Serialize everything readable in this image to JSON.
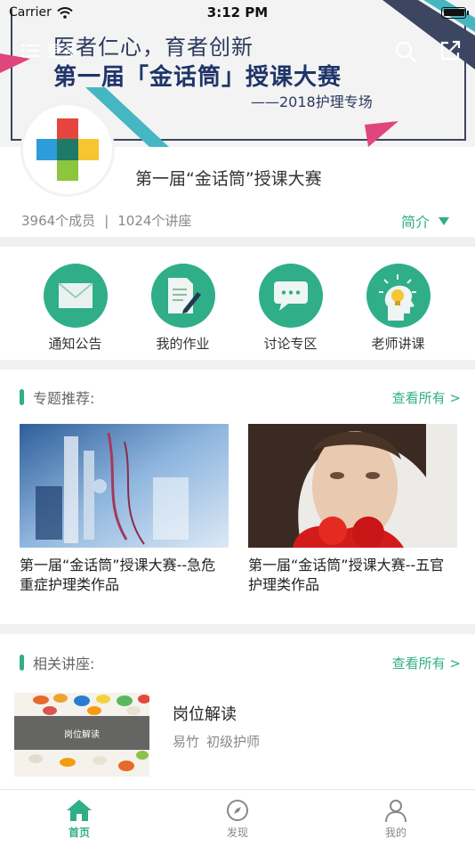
{
  "status_bar": {
    "carrier": "Carrier",
    "time": "3:12 PM"
  },
  "banner": {
    "line1": "医者仁心，育者创新",
    "line2": "第一届「金话筒」授课大赛",
    "line3": "——2018护理专场",
    "menu_label": "更多"
  },
  "course": {
    "title": "第一届“金话筒”授课大赛",
    "members": "3964个成员",
    "separator": "|",
    "lectures": "1024个讲座",
    "intro_label": "简介"
  },
  "quick_actions": [
    {
      "label": "通知公告",
      "icon": "envelope-icon"
    },
    {
      "label": "我的作业",
      "icon": "homework-edit-icon"
    },
    {
      "label": "讨论专区",
      "icon": "chat-bubble-icon"
    },
    {
      "label": "老师讲课",
      "icon": "lightbulb-head-icon"
    }
  ],
  "topics_section": {
    "title": "专题推荐:",
    "more": "查看所有 >",
    "items": [
      {
        "title": "第一届“金话筒”授课大赛--急危重症护理类作品"
      },
      {
        "title": "第一届“金话筒”授课大赛--五官护理类作品"
      }
    ]
  },
  "lectures_section": {
    "title": "相关讲座:",
    "more": "查看所有 >",
    "items": [
      {
        "thumb_label": "岗位解读",
        "title": "岗位解读",
        "author": "易竹",
        "level": "初级护师"
      }
    ]
  },
  "tabbar": {
    "tabs": [
      {
        "label": "首页",
        "icon": "home-icon",
        "active": true
      },
      {
        "label": "发现",
        "icon": "compass-icon",
        "active": false
      },
      {
        "label": "我的",
        "icon": "person-icon",
        "active": false
      }
    ]
  },
  "colors": {
    "accent": "#2fae88",
    "banner_navy": "#1f3569",
    "banner_teal": "#46b7c2",
    "banner_pink": "#e0457e"
  }
}
